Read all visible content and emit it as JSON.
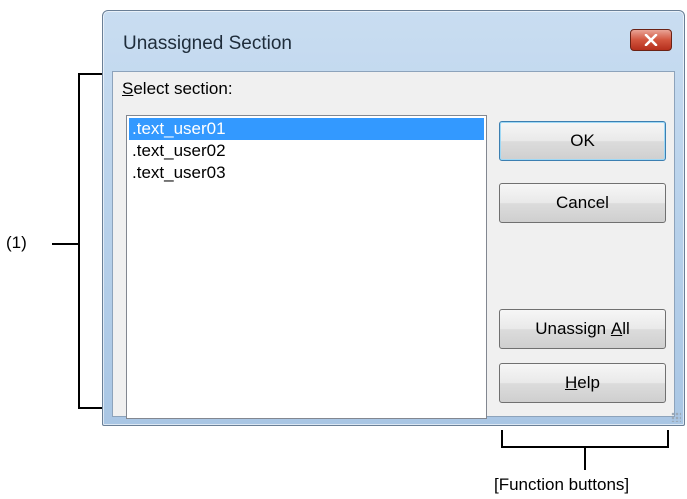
{
  "dialog": {
    "title": "Unassigned Section",
    "close_icon": "close-icon",
    "select_label_prefix": "S",
    "select_label_rest": "elect section:",
    "sections": [
      ".text_user01",
      ".text_user02",
      ".text_user03"
    ],
    "selected_index": 0,
    "buttons": {
      "ok": "OK",
      "cancel": "Cancel",
      "unassign_all_pre": "Unassign ",
      "unassign_all_key": "A",
      "unassign_all_post": "ll",
      "help_key": "H",
      "help_post": "elp"
    }
  },
  "annotations": {
    "area_label": "(1)",
    "function_buttons_label": "[Function buttons]"
  },
  "colors": {
    "selection": "#3399ff",
    "close_button": "#c7412a",
    "frame": "#b6d0ea"
  }
}
